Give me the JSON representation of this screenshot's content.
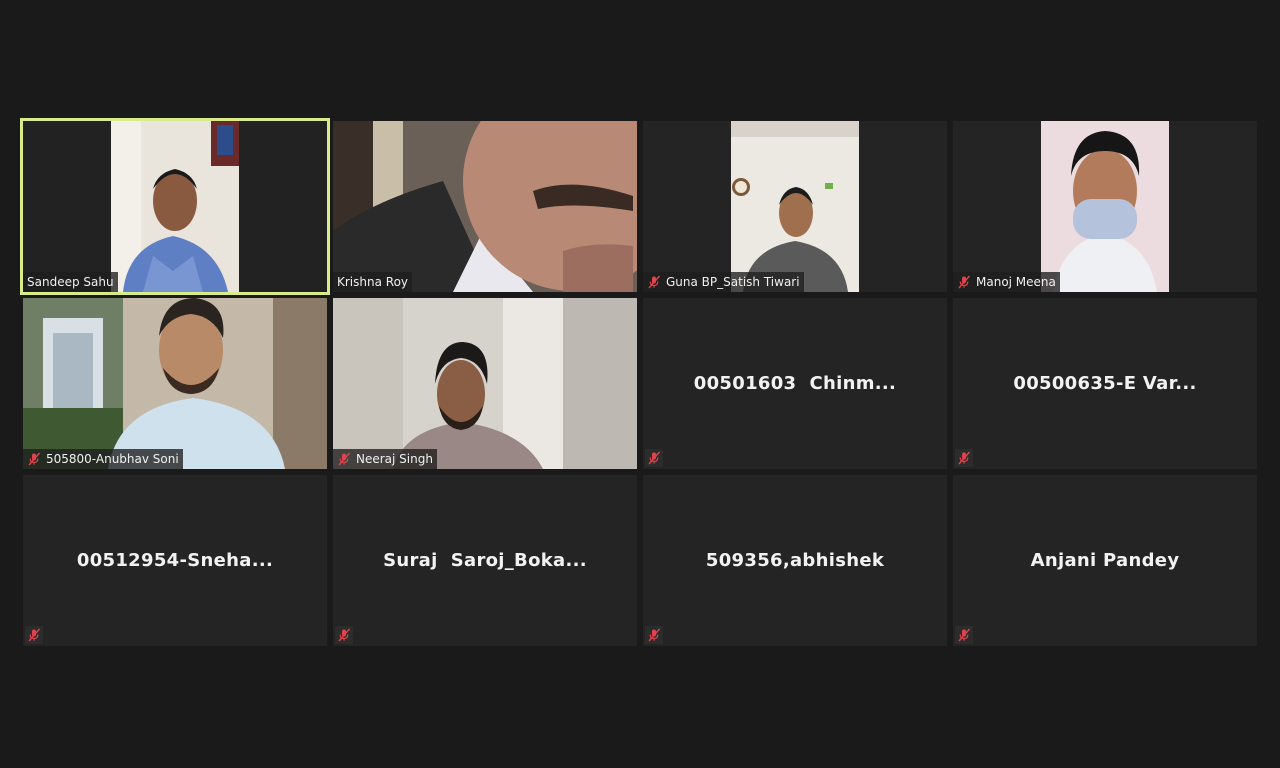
{
  "meeting": {
    "tiles": [
      {
        "name": "Sandeep Sahu",
        "muted": false,
        "video": true
      },
      {
        "name": "Krishna Roy",
        "muted": false,
        "video": true
      },
      {
        "name": "Guna BP_Satish Tiwari",
        "muted": true,
        "video": true
      },
      {
        "name": "Manoj Meena",
        "muted": true,
        "video": true
      },
      {
        "name": "505800-Anubhav Soni",
        "muted": true,
        "video": true
      },
      {
        "name": "Neeraj Singh",
        "muted": true,
        "video": true
      },
      {
        "name": "00501603  Chinm...",
        "muted": true,
        "video": false
      },
      {
        "name": "00500635-E Var...",
        "muted": true,
        "video": false
      },
      {
        "name": "00512954-Sneha...",
        "muted": true,
        "video": false
      },
      {
        "name": "Suraj  Saroj_Boka...",
        "muted": true,
        "video": false
      },
      {
        "name": "509356,abhishek",
        "muted": true,
        "video": false
      },
      {
        "name": "Anjani Pandey",
        "muted": true,
        "video": false
      }
    ]
  },
  "colors": {
    "background": "#1a1a1a",
    "tile": "#242424",
    "active_speaker_border": "#d8ec8a",
    "mute_red": "#e0434b"
  },
  "icons": {
    "mute": "microphone-muted-icon"
  }
}
